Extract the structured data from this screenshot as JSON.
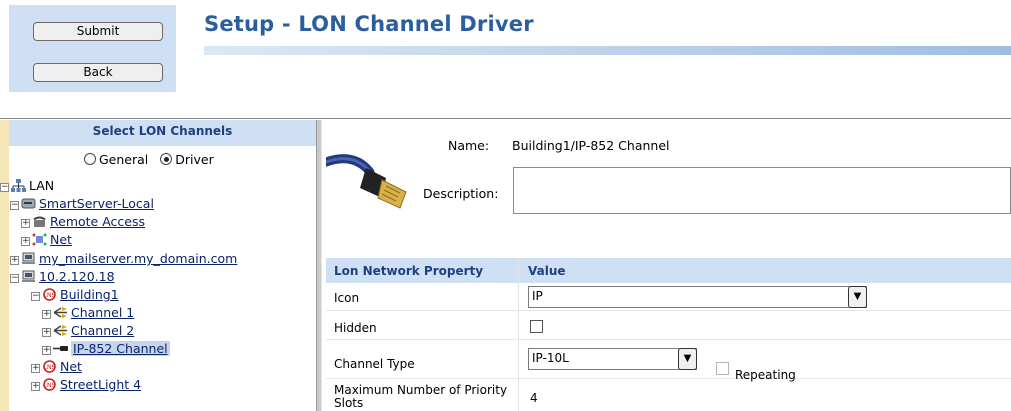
{
  "toolbar": {
    "submit_label": "Submit",
    "back_label": "Back"
  },
  "page": {
    "title": "Setup - LON Channel Driver"
  },
  "tree": {
    "header": "Select LON Channels",
    "radios": [
      {
        "label": "General",
        "selected": false
      },
      {
        "label": "Driver",
        "selected": true
      }
    ],
    "nodes": [
      {
        "label": "LAN",
        "icon": "network-icon",
        "toggle": "minus"
      },
      {
        "label": "SmartServer-Local",
        "icon": "server-icon",
        "toggle": "minus"
      },
      {
        "label": "Remote Access",
        "icon": "telephone-icon",
        "toggle": "plus"
      },
      {
        "label": "Net",
        "icon": "net-icon",
        "toggle": "plus"
      },
      {
        "label": "my_mailserver.my_domain.com",
        "icon": "computer-icon",
        "toggle": "plus"
      },
      {
        "label": "10.2.120.18",
        "icon": "computer-icon",
        "toggle": "minus"
      },
      {
        "label": "Building1",
        "icon": "lns-icon",
        "toggle": "minus"
      },
      {
        "label": "Channel 1",
        "icon": "channel-icon",
        "toggle": "plus"
      },
      {
        "label": "Channel 2",
        "icon": "channel-icon",
        "toggle": "plus"
      },
      {
        "label": "IP-852 Channel",
        "icon": "ip-channel-icon",
        "toggle": "plus",
        "selected": true
      },
      {
        "label": "Net",
        "icon": "lns-icon",
        "toggle": "plus"
      },
      {
        "label": "StreetLight 4",
        "icon": "lns-icon",
        "toggle": "plus"
      }
    ]
  },
  "details": {
    "name_label": "Name:",
    "name_value": "Building1/IP-852 Channel",
    "description_label": "Description:",
    "description_value": ""
  },
  "grid": {
    "col_property": "Lon Network Property",
    "col_value": "Value",
    "rows": {
      "icon": {
        "label": "Icon",
        "value": "IP"
      },
      "hidden": {
        "label": "Hidden",
        "checked": false
      },
      "channel_type": {
        "label": "Channel Type",
        "value": "IP-10L",
        "repeating_label": "Repeating",
        "repeating_checked": false
      },
      "max_slots": {
        "label": "Maximum Number of Priority Slots",
        "value": "4"
      }
    }
  },
  "colors": {
    "accent": "#2b5e9c",
    "panel": "#cfe0f5",
    "strip": "#f4e6b6"
  }
}
